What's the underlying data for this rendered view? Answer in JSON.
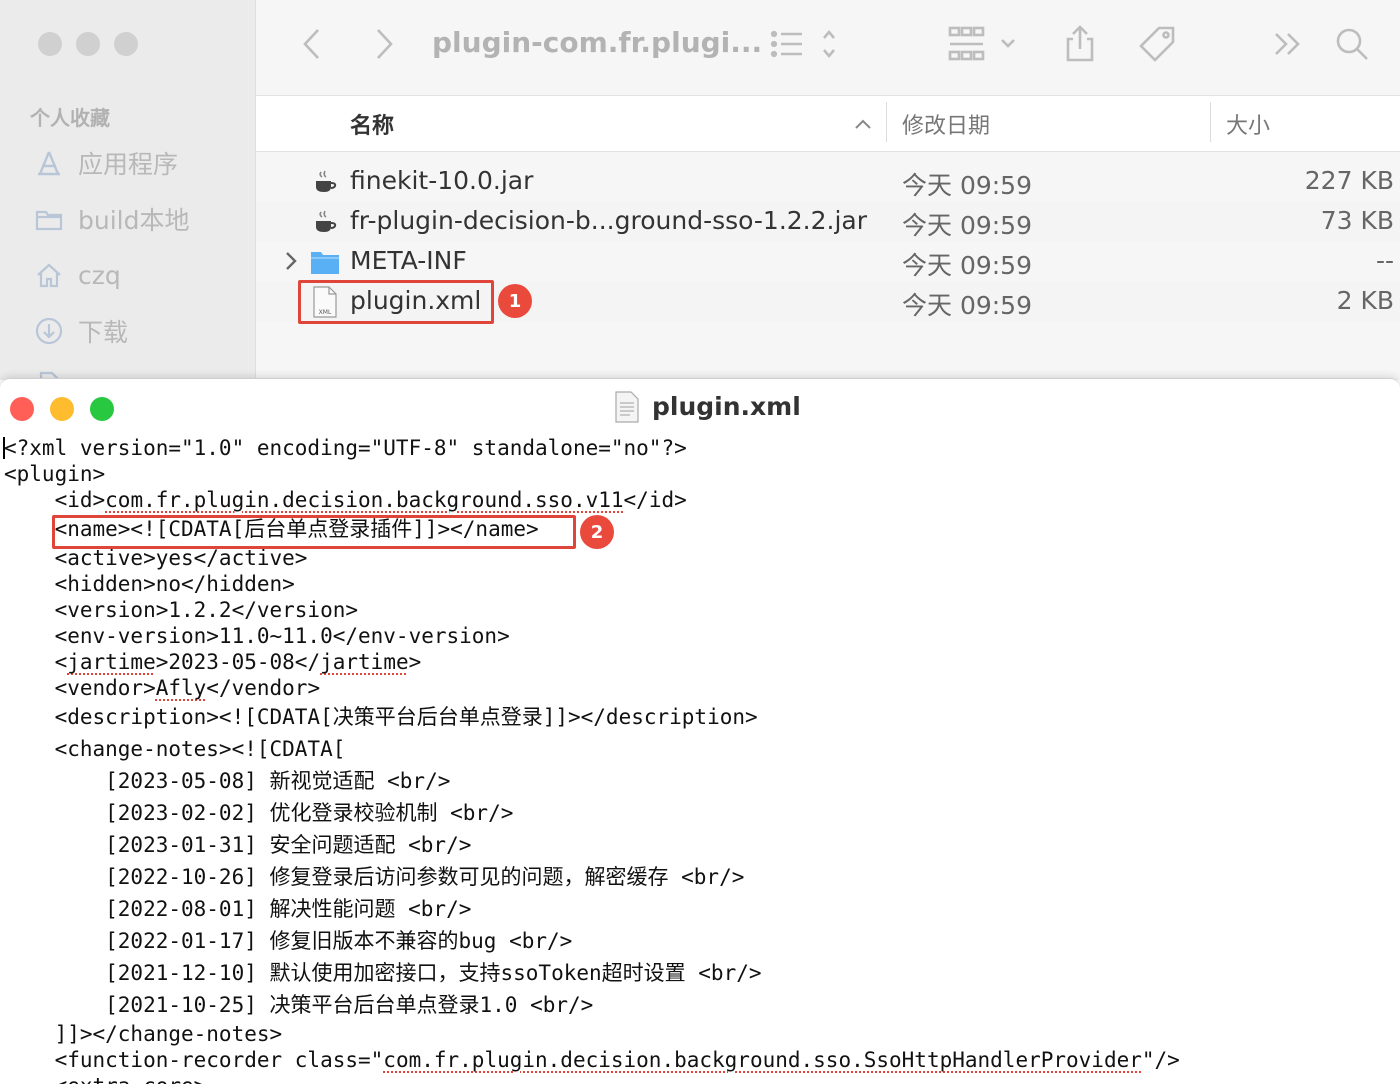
{
  "finder": {
    "title": "plugin-com.fr.plugi...",
    "sidebar": {
      "heading": "个人收藏",
      "items": [
        {
          "label": "应用程序",
          "icon": "applications-icon"
        },
        {
          "label": "build本地",
          "icon": "folder-icon"
        },
        {
          "label": "czq",
          "icon": "home-icon"
        },
        {
          "label": "下载",
          "icon": "download-icon"
        }
      ]
    },
    "columns": {
      "name": "名称",
      "date": "修改日期",
      "size": "大小"
    },
    "files": [
      {
        "name": "finekit-10.0.jar",
        "date": "今天 09:59",
        "size": "227 KB",
        "icon": "java-jar-icon"
      },
      {
        "name": "fr-plugin-decision-b...ground-sso-1.2.2.jar",
        "date": "今天 09:59",
        "size": "73 KB",
        "icon": "java-jar-icon"
      },
      {
        "name": "META-INF",
        "date": "今天 09:59",
        "size": "--",
        "icon": "folder-icon"
      },
      {
        "name": "plugin.xml",
        "date": "今天 09:59",
        "size": "2 KB",
        "icon": "xml-file-icon"
      }
    ],
    "xml_icon_label": "XML"
  },
  "annotations": {
    "badge1": "1",
    "badge2": "2"
  },
  "editor": {
    "title": "plugin.xml",
    "lines": {
      "l1": "<?xml version=\"1.0\" encoding=\"UTF-8\" standalone=\"no\"?>",
      "l2": "<plugin>",
      "l3a": "    <id>",
      "l3b": "com.fr.plugin.decision.background.sso.v11",
      "l3c": "</id>",
      "l4": "    <name><![CDATA[后台单点登录插件]]></name>",
      "l5": "    <active>yes</active>",
      "l6": "    <hidden>no</hidden>",
      "l7": "    <version>1.2.2</version>",
      "l8": "    <env-version>11.0~11.0</env-version>",
      "l9a": "    <",
      "l9b": "jartime",
      "l9c": ">2023-05-08</",
      "l9d": "jartime",
      "l9e": ">",
      "l10a": "    <vendor>",
      "l10b": "Afly",
      "l10c": "</vendor>",
      "l11": "    <description><![CDATA[决策平台后台单点登录]]></description>",
      "l12": "    <change-notes><![CDATA[",
      "l13": "        [2023-05-08] 新视觉适配 <br/>",
      "l14": "        [2023-02-02] 优化登录校验机制 <br/>",
      "l15": "        [2023-01-31] 安全问题适配 <br/>",
      "l16": "        [2022-10-26] 修复登录后访问参数可见的问题，解密缓存 <br/>",
      "l17": "        [2022-08-01] 解决性能问题 <br/>",
      "l18": "        [2022-01-17] 修复旧版本不兼容的bug <br/>",
      "l19": "        [2021-12-10] 默认使用加密接口，支持ssoToken超时设置 <br/>",
      "l20": "        [2021-10-25] 决策平台后台单点登录1.0 <br/>",
      "l21": "    ]]></change-notes>",
      "l22a": "    <function-recorder class=\"",
      "l22b": "com.fr.plugin.decision.background.sso.SsoHttpHandlerProvider",
      "l22c": "\"/>",
      "l23": "    <extra-core>"
    }
  },
  "colors": {
    "highlight": "#e0453a",
    "close": "#ff5f57",
    "minimize": "#febc2e",
    "zoom": "#28c840",
    "folder": "#5ab0f5"
  }
}
